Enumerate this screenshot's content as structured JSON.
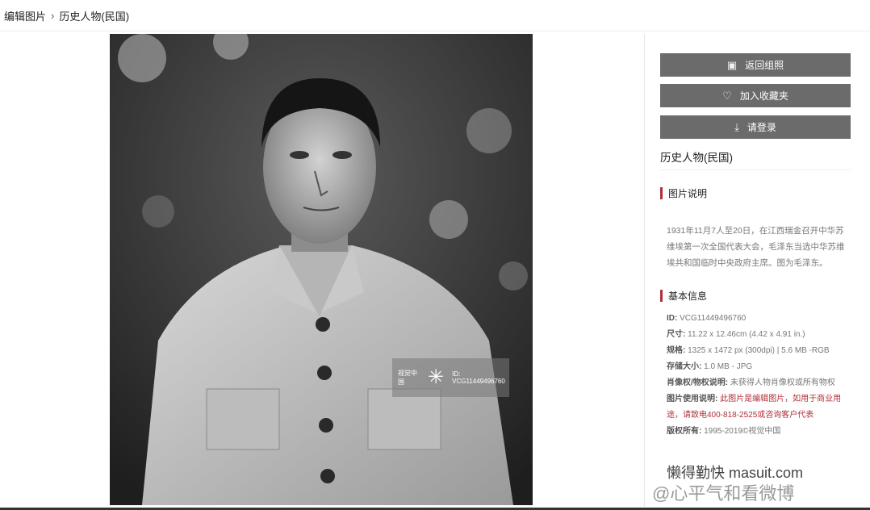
{
  "breadcrumb": {
    "root": "编辑图片",
    "separator": "›",
    "current": "历史人物(民国)"
  },
  "photo": {
    "watermark_brand": "视觉中国",
    "watermark_id": "ID: VCG11449496760"
  },
  "buttons": {
    "back": "返回组照",
    "favorite": "加入收藏夹",
    "login": "请登录"
  },
  "category": "历史人物(民国)",
  "description": {
    "heading": "图片说明",
    "text": "1931年11月7人至20日，在江西瑞金召开中华苏维埃第一次全国代表大会，毛泽东当选中华苏维埃共和国临时中央政府主席。图为毛泽东。"
  },
  "basic_info": {
    "heading": "基本信息",
    "id_label": "ID:",
    "id_value": "VCG11449496760",
    "size_label": "尺寸:",
    "size_value": "11.22 x 12.46cm (4.42 x 4.91 in.)",
    "spec_label": "规格:",
    "spec_value": "1325 x 1472 px (300dpi) | 5.6 MB -RGB",
    "storage_label": "存储大小:",
    "storage_value": "1.0 MB - JPG",
    "rights_label": "肖像权/物权说明:",
    "rights_value": "未获得人物肖像权或所有物权",
    "usage_label": "图片使用说明:",
    "usage_value": "此图片是编辑图片，如用于商业用途，请致电400-818-2525或咨询客户代表",
    "copyright_label": "版权所有:",
    "copyright_value": "1995-2019©视觉中国"
  },
  "overlay_watermarks": {
    "site": "懒得勤快 masuit.com",
    "weibo": "@心平气和看微博"
  }
}
